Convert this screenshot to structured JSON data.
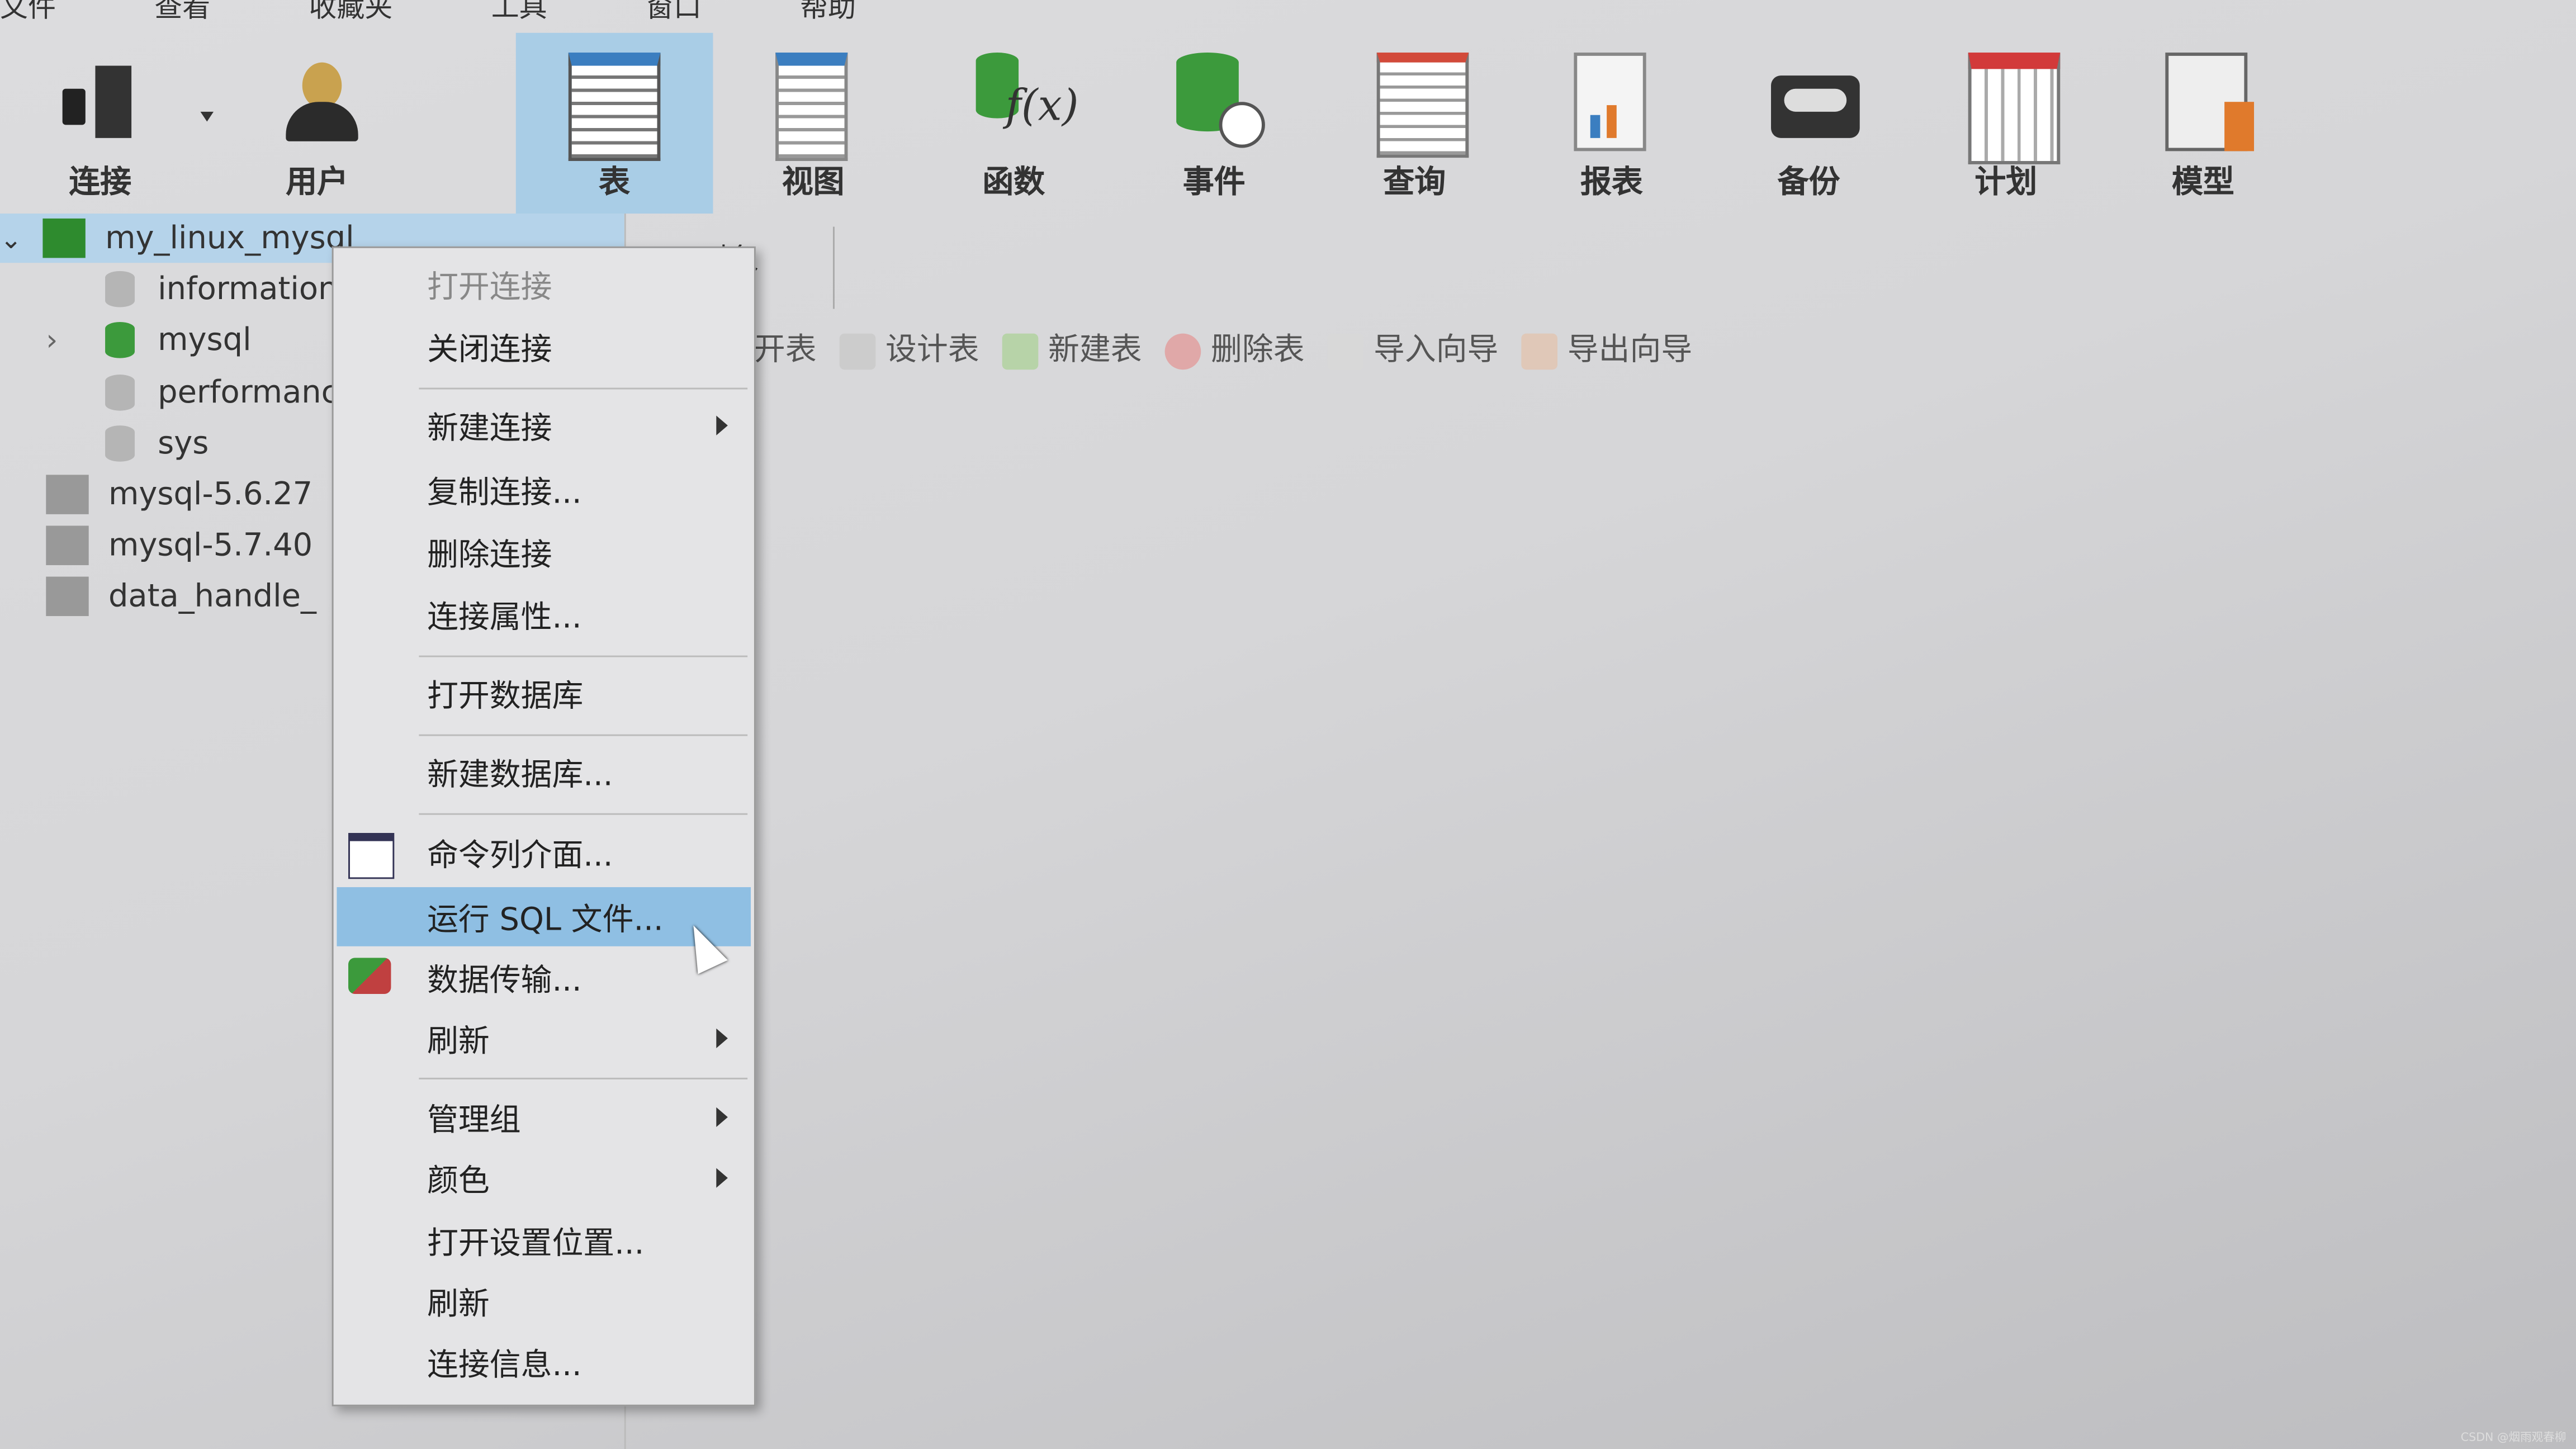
{
  "menubar": [
    "文件",
    "查看",
    "收藏夹",
    "工具",
    "窗口",
    "帮助"
  ],
  "toolbar": [
    {
      "label": "连接",
      "icon": "plug-server-icon"
    },
    {
      "label": "用户",
      "icon": "user-icon"
    },
    {
      "label": "表",
      "icon": "table-icon",
      "active": true
    },
    {
      "label": "视图",
      "icon": "view-icon"
    },
    {
      "label": "函数",
      "icon": "function-icon"
    },
    {
      "label": "事件",
      "icon": "event-icon"
    },
    {
      "label": "查询",
      "icon": "query-icon"
    },
    {
      "label": "报表",
      "icon": "report-icon"
    },
    {
      "label": "备份",
      "icon": "backup-icon"
    },
    {
      "label": "计划",
      "icon": "schedule-icon"
    },
    {
      "label": "模型",
      "icon": "model-icon"
    }
  ],
  "tree": [
    {
      "label": "my_linux_mysql",
      "level": 0,
      "type": "connection",
      "open": true,
      "selected": true
    },
    {
      "label": "information_schema",
      "level": 1,
      "type": "db"
    },
    {
      "label": "mysql",
      "level": 1,
      "type": "db",
      "open": true
    },
    {
      "label": "performance_schema",
      "level": 1,
      "type": "db"
    },
    {
      "label": "sys",
      "level": 1,
      "type": "db"
    },
    {
      "label": "mysql-5.6.27",
      "level": 0,
      "type": "connection"
    },
    {
      "label": "mysql-5.7.40",
      "level": 0,
      "type": "connection"
    },
    {
      "label": "data_handle_",
      "level": 0,
      "type": "connection"
    }
  ],
  "object_tab": "对象",
  "object_toolbar": [
    "打开表",
    "设计表",
    "新建表",
    "删除表",
    "导入向导",
    "导出向导"
  ],
  "context_menu": [
    {
      "label": "打开连接",
      "disabled": true
    },
    {
      "label": "关闭连接"
    },
    {
      "label": "新建连接",
      "submenu": true
    },
    {
      "label": "复制连接..."
    },
    {
      "label": "删除连接"
    },
    {
      "label": "连接属性..."
    },
    {
      "label": "打开数据库"
    },
    {
      "label": "新建数据库..."
    },
    {
      "label": "命令列介面...",
      "icon": "console-icon"
    },
    {
      "label": "运行 SQL 文件...",
      "highlighted": true
    },
    {
      "label": "数据传输...",
      "icon": "data-transfer-icon"
    },
    {
      "label": "刷新",
      "submenu": true
    },
    {
      "label": "管理组",
      "submenu": true
    },
    {
      "label": "颜色",
      "submenu": true
    },
    {
      "label": "打开设置位置..."
    },
    {
      "label": "刷新"
    },
    {
      "label": "连接信息..."
    }
  ],
  "watermark": "CSDN @烟雨观春柳",
  "colors": {
    "selection": "#8fbfe3",
    "active_tool": "#a9cde6",
    "db_active": "#3c9a3c"
  }
}
